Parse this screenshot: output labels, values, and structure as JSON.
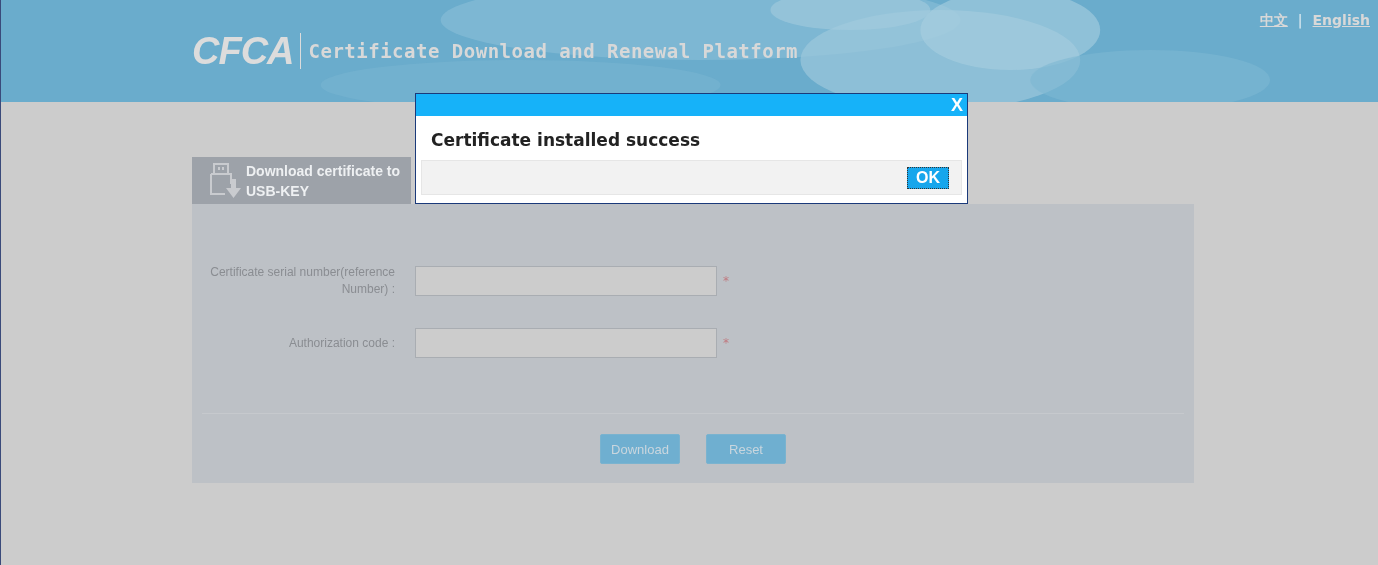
{
  "header": {
    "logo": "CFCA",
    "title": "Certificate Download and Renewal Platform",
    "languages": [
      {
        "label": "中文"
      },
      {
        "label": "English"
      }
    ],
    "separator": "|"
  },
  "tab": {
    "label": "Download certificate to USB-KEY"
  },
  "form": {
    "fields": [
      {
        "label": "Certificate serial number(reference Number) :",
        "required": "*"
      },
      {
        "label": "Authorization code :",
        "required": "*"
      }
    ],
    "buttons": [
      "Download",
      "Reset"
    ]
  },
  "dialog": {
    "close": "X",
    "message": "Certificate installed success",
    "ok": "OK"
  }
}
